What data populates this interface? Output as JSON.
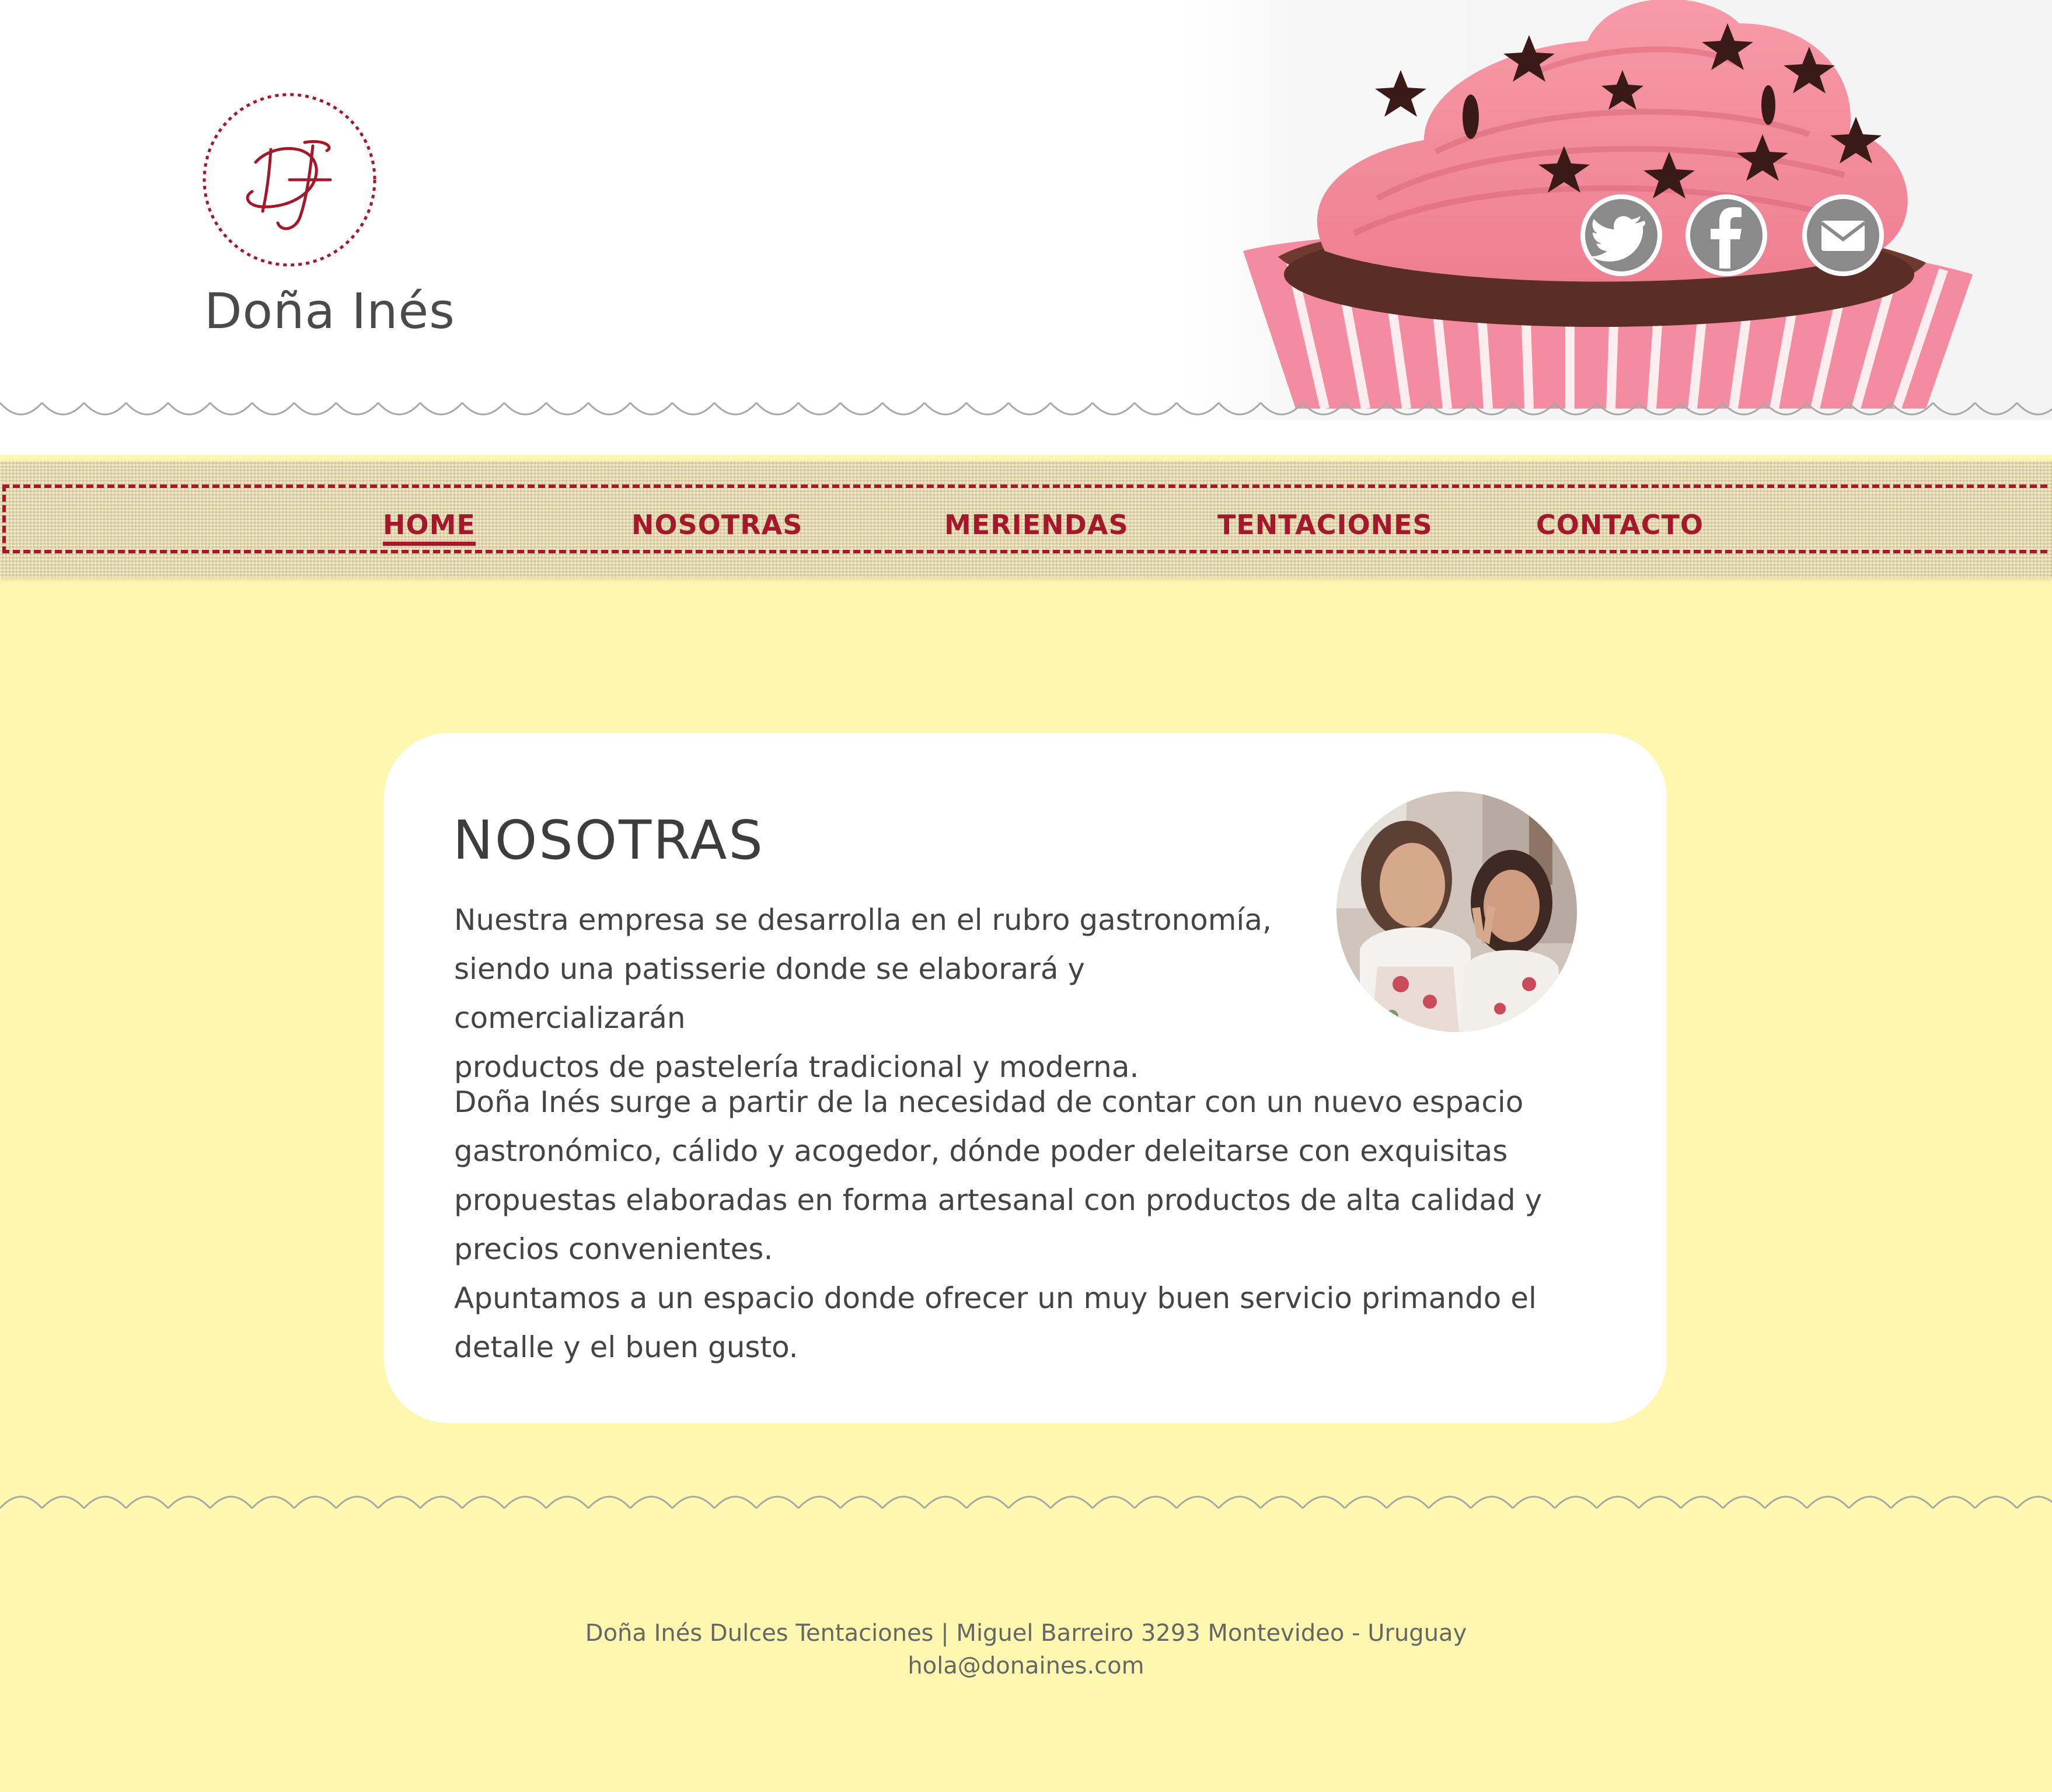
{
  "brand": {
    "monogram": "DI",
    "name": "Doña Inés"
  },
  "social": [
    {
      "name": "twitter",
      "icon": "twitter-icon"
    },
    {
      "name": "facebook",
      "icon": "facebook-icon"
    },
    {
      "name": "email",
      "icon": "mail-icon"
    }
  ],
  "nav": {
    "items": [
      "HOME",
      "NOSOTRAS",
      "MERIENDAS",
      "TENTACIONES",
      "CONTACTO"
    ],
    "active": "HOME"
  },
  "main": {
    "title": "NOSOTRAS",
    "paragraph_1": "Nuestra empresa se desarrolla en el rubro gastronomía,\nsiendo una patisserie donde se  elaborará y comercializarán\nproductos de pastelería tradicional y moderna.",
    "paragraph_2": "Doña Inés surge a partir de la necesidad de contar con un nuevo espacio\ngastronómico, cálido y acogedor, dónde poder deleitarse con exquisitas\npropuestas elaboradas en forma artesanal con productos de alta calidad y\nprecios convenientes.\nApuntamos a un espacio donde ofrecer un muy buen servicio primando el\ndetalle y el buen gusto."
  },
  "footer": {
    "line_1": "Doña Inés Dulces Tentaciones | Miguel Barreiro  3293  Montevideo - Uruguay",
    "line_2": "hola@donaines.com"
  },
  "colors": {
    "accent": "#a3182a",
    "background": "#fef7b0",
    "ribbon": "#e8dcaa",
    "icon_gray": "#8a8a8a"
  }
}
